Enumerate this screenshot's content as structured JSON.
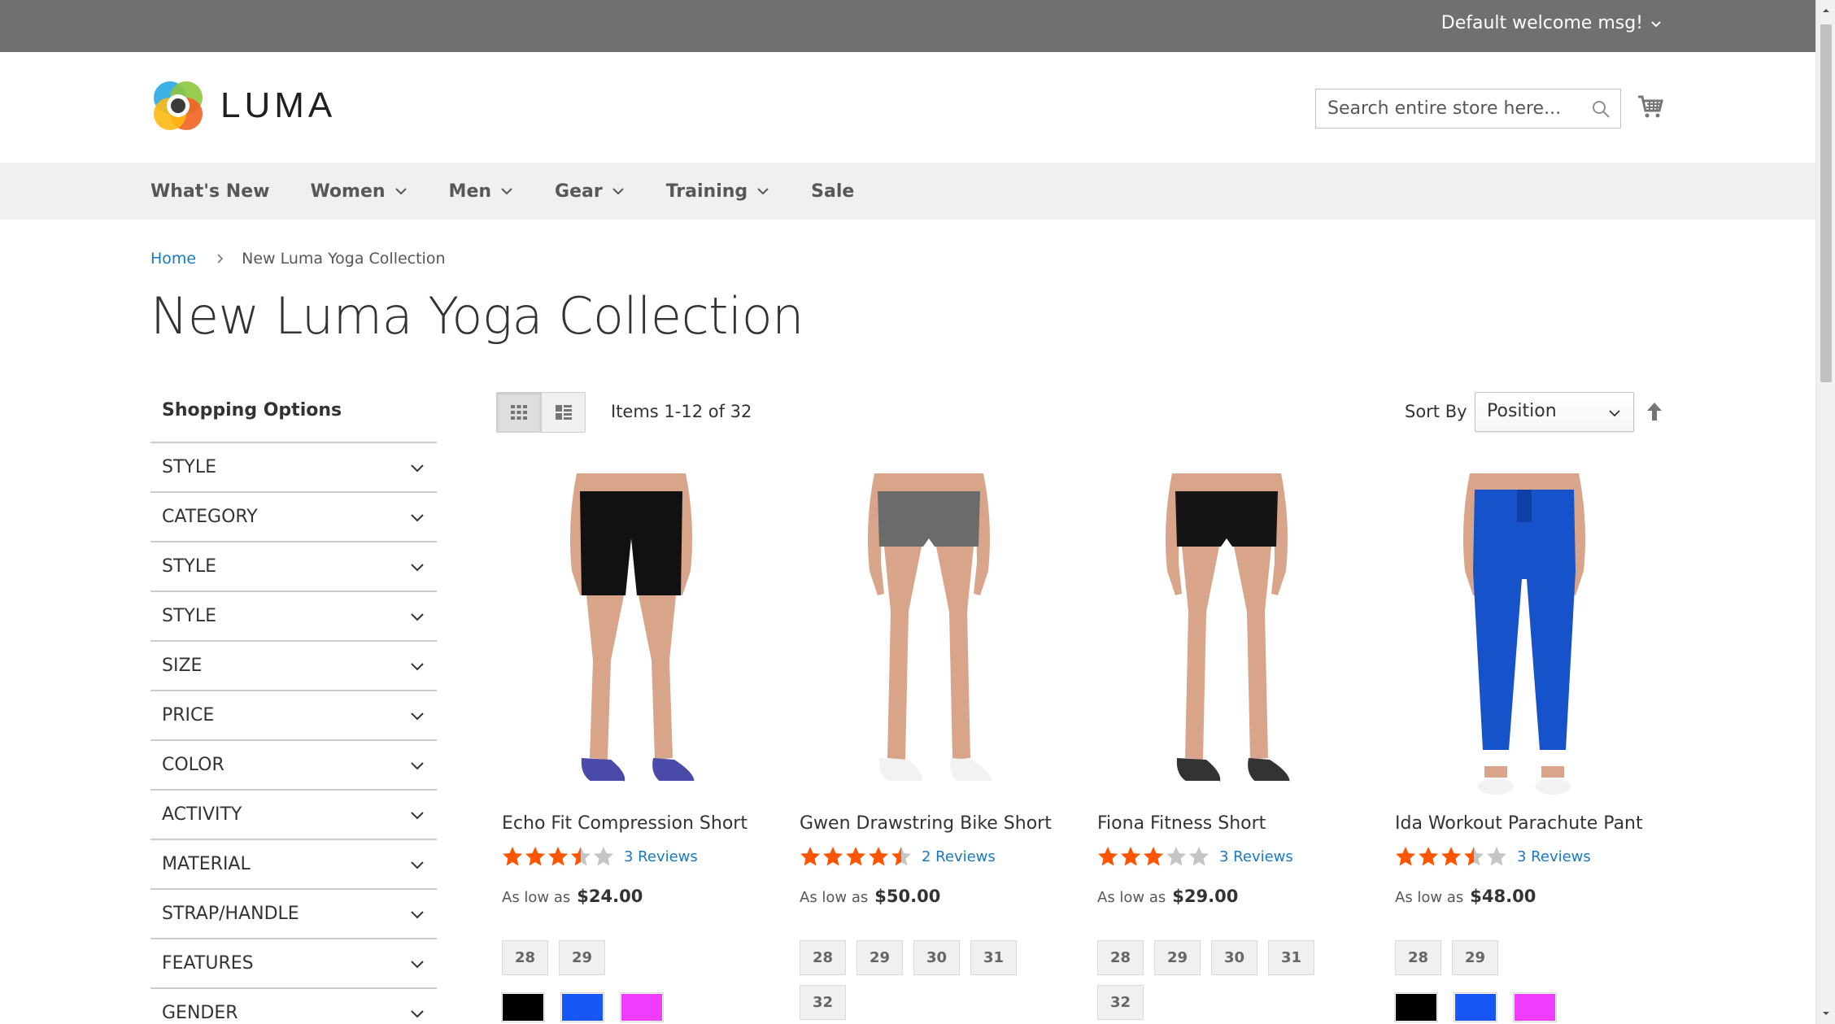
{
  "top_panel": {
    "welcome": "Default welcome msg!"
  },
  "header": {
    "logo_text": "LUMA",
    "search_placeholder": "Search entire store here..."
  },
  "nav": {
    "items": [
      {
        "label": "What's New",
        "has_dropdown": false
      },
      {
        "label": "Women",
        "has_dropdown": true
      },
      {
        "label": "Men",
        "has_dropdown": true
      },
      {
        "label": "Gear",
        "has_dropdown": true
      },
      {
        "label": "Training",
        "has_dropdown": true
      },
      {
        "label": "Sale",
        "has_dropdown": false
      }
    ]
  },
  "breadcrumbs": {
    "home": "Home",
    "current": "New Luma Yoga Collection"
  },
  "page_title": "New Luma Yoga Collection",
  "sidebar": {
    "title": "Shopping Options",
    "filters": [
      "Style",
      "Category",
      "Style",
      "Style",
      "Size",
      "Price",
      "Color",
      "Activity",
      "Material",
      "Strap/Handle",
      "Features",
      "Gender"
    ]
  },
  "toolbar": {
    "amount": "Items 1-12 of 32",
    "sort_label": "Sort By",
    "sort_value": "Position"
  },
  "products": [
    {
      "name": "Echo Fit Compression Short",
      "rating": 3.5,
      "reviews": "3 Reviews",
      "price_label": "As low as",
      "price": "$24.00",
      "sizes": [
        "28",
        "29"
      ],
      "colors": [
        "#000000",
        "#1857f7",
        "#ef3dff"
      ]
    },
    {
      "name": "Gwen Drawstring Bike Short",
      "rating": 4.5,
      "reviews": "2 Reviews",
      "price_label": "As low as",
      "price": "$50.00",
      "sizes": [
        "28",
        "29",
        "30",
        "31",
        "32"
      ],
      "colors": []
    },
    {
      "name": "Fiona Fitness Short",
      "rating": 3,
      "reviews": "3 Reviews",
      "price_label": "As low as",
      "price": "$29.00",
      "sizes": [
        "28",
        "29",
        "30",
        "31",
        "32"
      ],
      "colors": []
    },
    {
      "name": "Ida Workout Parachute Pant",
      "rating": 3.5,
      "reviews": "3 Reviews",
      "price_label": "As low as",
      "price": "$48.00",
      "sizes": [
        "28",
        "29"
      ],
      "colors": [
        "#000000",
        "#1857f7",
        "#ef3dff"
      ]
    }
  ],
  "colors": {
    "star_on": "#ff5501",
    "star_off": "#c5c5c5",
    "link": "#1979c3",
    "top_panel": "#6e716e"
  }
}
